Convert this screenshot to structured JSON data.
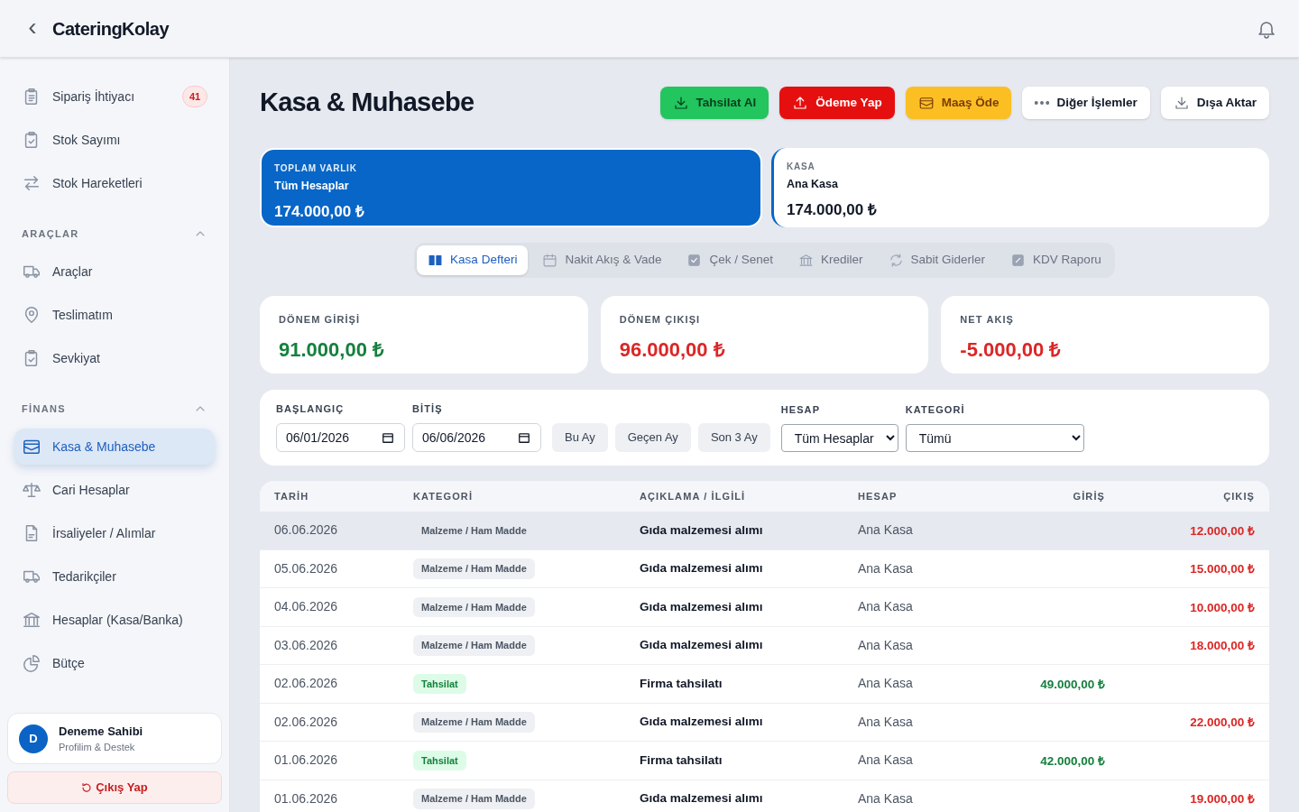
{
  "header": {
    "back": "‹",
    "app_name": "CateringKolay"
  },
  "sidebar": {
    "sections": [
      {
        "items": [
          {
            "label": "Sipariş İhtiyacı",
            "badge": "41",
            "selected": false
          },
          {
            "label": "Stok Sayımı",
            "selected": false
          },
          {
            "label": "Stok Hareketleri",
            "selected": false
          }
        ]
      },
      {
        "title": "ARAÇLAR",
        "expanded": true,
        "items": [
          {
            "label": "Araçlar",
            "selected": false
          },
          {
            "label": "Teslimatım",
            "selected": false
          },
          {
            "label": "Sevkiyat",
            "selected": false
          }
        ]
      },
      {
        "title": "FİNANS",
        "expanded": true,
        "items": [
          {
            "label": "Kasa & Muhasebe",
            "selected": true
          },
          {
            "label": "Cari Hesaplar",
            "selected": false
          },
          {
            "label": "İrsaliyeler / Alımlar",
            "selected": false
          },
          {
            "label": "Tedarikçiler",
            "selected": false
          },
          {
            "label": "Hesaplar (Kasa/Banka)",
            "selected": false
          },
          {
            "label": "Bütçe",
            "selected": false
          }
        ]
      }
    ],
    "profile": {
      "initial": "D",
      "name": "Deneme Sahibi",
      "subtitle": "Profilim & Destek"
    },
    "logout": "Çıkış Yap"
  },
  "page": {
    "title": "Kasa & Muhasebe",
    "actions": [
      {
        "label": "Tahsilat Al",
        "kind": "green"
      },
      {
        "label": "Ödeme Yap",
        "kind": "red"
      },
      {
        "label": "Maaş Öde",
        "kind": "amber"
      },
      {
        "label": "Diğer İşlemler",
        "kind": "plain"
      },
      {
        "label": "Dışa Aktar",
        "kind": "plain"
      }
    ],
    "accounts": [
      {
        "caption": "TOPLAM VARLIK",
        "name": "Tüm Hesaplar",
        "amount": "174.000,00 ₺",
        "selected": true
      },
      {
        "caption": "KASA",
        "name": "Ana Kasa",
        "amount": "174.000,00 ₺",
        "selected": false
      }
    ],
    "tabs": [
      {
        "label": "Kasa Defteri",
        "selected": true
      },
      {
        "label": "Nakit Akış & Vade",
        "selected": false
      },
      {
        "label": "Çek / Senet",
        "selected": false
      },
      {
        "label": "Krediler",
        "selected": false
      },
      {
        "label": "Sabit Giderler",
        "selected": false
      },
      {
        "label": "KDV Raporu",
        "selected": false
      }
    ],
    "stats": [
      {
        "label": "DÖNEM GİRİŞİ",
        "value": "91.000,00 ₺",
        "color": "#15803d"
      },
      {
        "label": "DÖNEM ÇIKIŞI",
        "value": "96.000,00 ₺",
        "color": "#dc2626"
      },
      {
        "label": "NET AKIŞ",
        "value": "-5.000,00 ₺",
        "color": "#dc2626"
      }
    ],
    "filters": {
      "start": {
        "label": "BAŞLANGIÇ",
        "value": "06/01/2026"
      },
      "end": {
        "label": "BİTİŞ",
        "value": "06/06/2026"
      },
      "quick": [
        "Bu Ay",
        "Geçen Ay",
        "Son 3 Ay"
      ],
      "account": {
        "label": "HESAP",
        "value": "Tüm Hesaplar"
      },
      "category": {
        "label": "KATEGORİ",
        "value": "Tümü"
      }
    },
    "table": {
      "columns": [
        "TARİH",
        "KATEGORİ",
        "AÇIKLAMA / İLGİLİ",
        "HESAP",
        "GİRİŞ",
        "ÇIKIŞ"
      ],
      "rows": [
        {
          "date": "06.06.2026",
          "category": "Malzeme / Ham Madde",
          "kind": "expense",
          "description": "Gıda malzemesi alımı",
          "account": "Ana Kasa",
          "in": null,
          "out": "12.000,00 ₺",
          "selected": true
        },
        {
          "date": "05.06.2026",
          "category": "Malzeme / Ham Madde",
          "kind": "expense",
          "description": "Gıda malzemesi alımı",
          "account": "Ana Kasa",
          "in": null,
          "out": "15.000,00 ₺",
          "selected": false
        },
        {
          "date": "04.06.2026",
          "category": "Malzeme / Ham Madde",
          "kind": "expense",
          "description": "Gıda malzemesi alımı",
          "account": "Ana Kasa",
          "in": null,
          "out": "10.000,00 ₺",
          "selected": false
        },
        {
          "date": "03.06.2026",
          "category": "Malzeme / Ham Madde",
          "kind": "expense",
          "description": "Gıda malzemesi alımı",
          "account": "Ana Kasa",
          "in": null,
          "out": "18.000,00 ₺",
          "selected": false
        },
        {
          "date": "02.06.2026",
          "category": "Tahsilat",
          "kind": "income",
          "description": "Firma tahsilatı",
          "account": "Ana Kasa",
          "in": "49.000,00 ₺",
          "out": null,
          "selected": false
        },
        {
          "date": "02.06.2026",
          "category": "Malzeme / Ham Madde",
          "kind": "expense",
          "description": "Gıda malzemesi alımı",
          "account": "Ana Kasa",
          "in": null,
          "out": "22.000,00 ₺",
          "selected": false
        },
        {
          "date": "01.06.2026",
          "category": "Tahsilat",
          "kind": "income",
          "description": "Firma tahsilatı",
          "account": "Ana Kasa",
          "in": "42.000,00 ₺",
          "out": null,
          "selected": false
        },
        {
          "date": "01.06.2026",
          "category": "Malzeme / Ham Madde",
          "kind": "expense",
          "description": "Gıda malzemesi alımı",
          "account": "Ana Kasa",
          "in": null,
          "out": "19.000,00 ₺",
          "selected": false
        }
      ]
    }
  }
}
